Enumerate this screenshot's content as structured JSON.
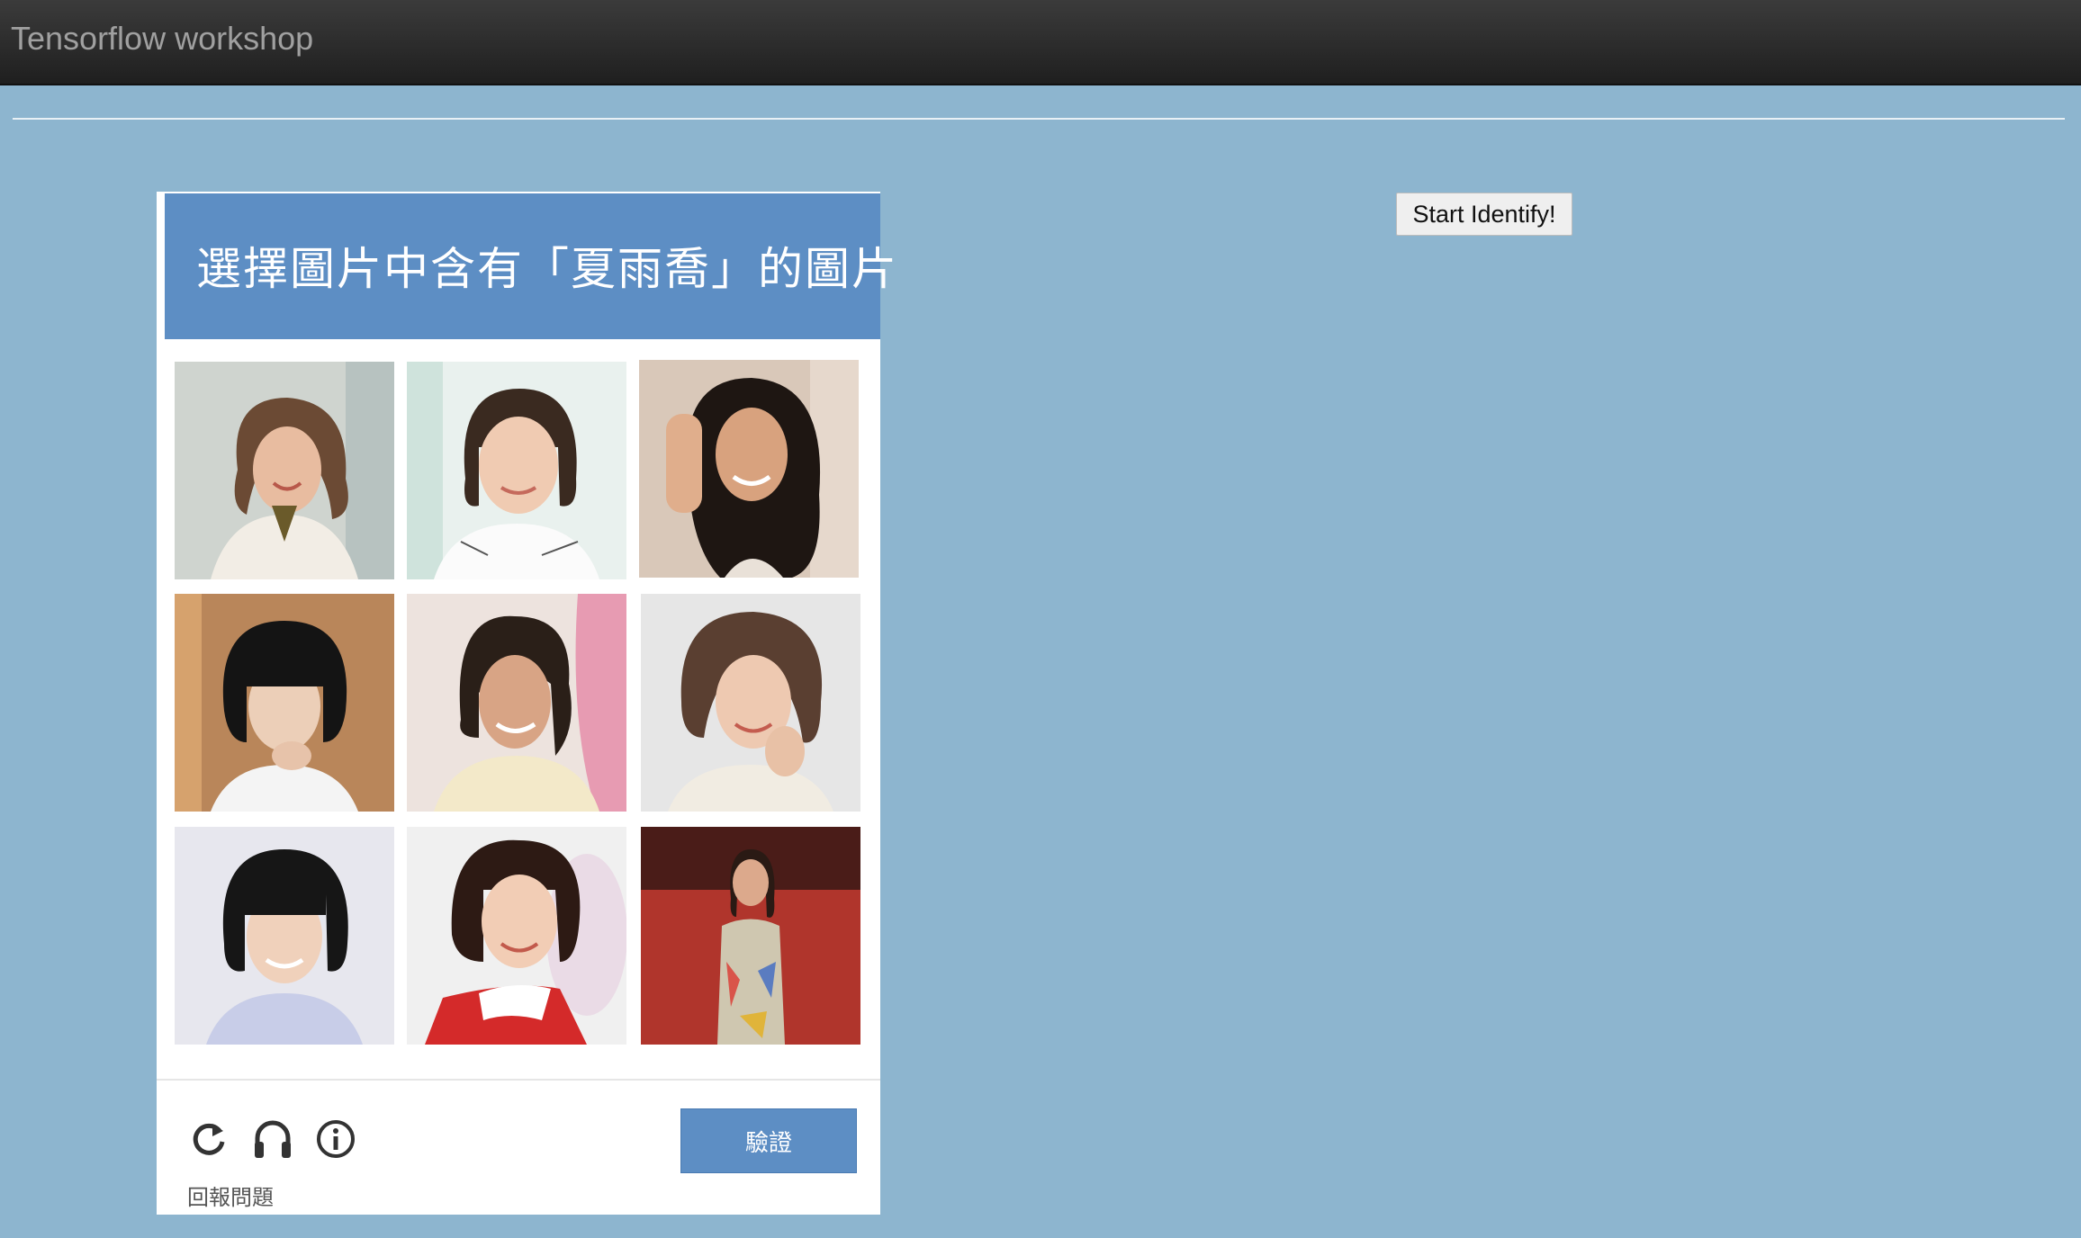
{
  "navbar": {
    "brand": "Tensorflow workshop"
  },
  "captcha": {
    "title": "選擇圖片中含有「夏雨喬」的圖片",
    "tiles": [
      {
        "label": "photo-1",
        "bg": "#cfd4cf"
      },
      {
        "label": "photo-2",
        "bg": "#e9f1ee"
      },
      {
        "label": "photo-3",
        "bg": "#d9c8b9"
      },
      {
        "label": "photo-4",
        "bg": "#b9865a"
      },
      {
        "label": "photo-5",
        "bg": "#ede3de"
      },
      {
        "label": "photo-6",
        "bg": "#e6e6e6"
      },
      {
        "label": "photo-7",
        "bg": "#e7e7ee"
      },
      {
        "label": "photo-8",
        "bg": "#f0f0f0"
      },
      {
        "label": "photo-9",
        "bg": "#b0352c"
      }
    ],
    "icons": {
      "reload": "reload-icon",
      "audio": "headphones-icon",
      "info": "info-icon"
    },
    "verify_label": "驗證",
    "report_label": "回報問題"
  },
  "start_button": "Start Identify!",
  "colors": {
    "page_bg": "#8db5cf",
    "navbar_bg": "#2b2b2b",
    "captcha_accent": "#5d8ec4"
  }
}
